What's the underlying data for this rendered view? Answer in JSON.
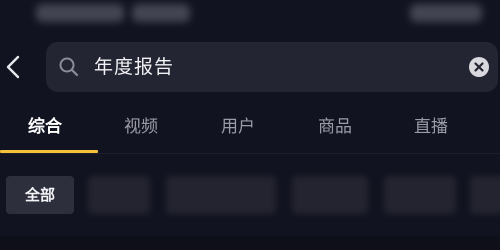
{
  "search": {
    "query": "年度报告"
  },
  "tabs": [
    {
      "label": "综合",
      "active": true
    },
    {
      "label": "视频",
      "active": false
    },
    {
      "label": "用户",
      "active": false
    },
    {
      "label": "商品",
      "active": false
    },
    {
      "label": "直播",
      "active": false
    }
  ],
  "filters": {
    "all_label": "全部"
  },
  "colors": {
    "background": "#121320",
    "search_box": "#242532",
    "tab_active": "#ffffff",
    "tab_inactive": "#9c9ca8",
    "accent_underline": "#f3c13a",
    "chip_background": "#2e2f3c"
  },
  "icons": {
    "back": "chevron-left-icon",
    "search": "search-icon",
    "clear": "clear-circle-icon"
  }
}
